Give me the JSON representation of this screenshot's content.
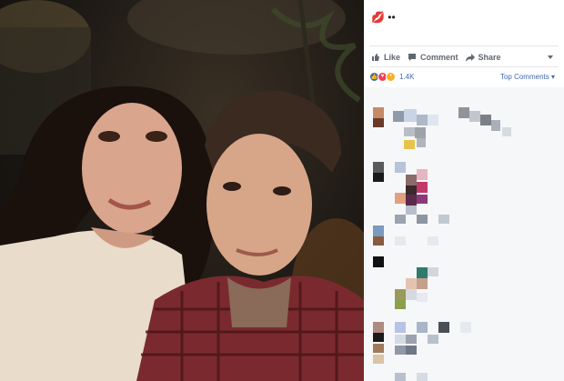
{
  "post": {
    "caption_text": "••",
    "caption_icon": "kiss-emoji-icon"
  },
  "actions": {
    "like_label": "Like",
    "comment_label": "Comment",
    "share_label": "Share"
  },
  "reactions": {
    "count": "1.4K",
    "top_comments_label": "Top Comments ▾",
    "icons": [
      "like-reaction-icon",
      "love-reaction-icon",
      "wow-reaction-icon"
    ],
    "colors": {
      "like": "#4267b2",
      "love": "#f33e58",
      "wow": "#f7b125"
    }
  },
  "colors": {
    "link": "#4267b2",
    "action_text": "#606770",
    "comment_bg": "#f6f7f9"
  }
}
